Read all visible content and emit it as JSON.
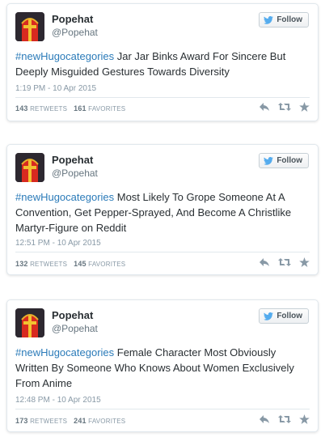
{
  "colors": {
    "hashtag": "#2b7bb9",
    "muted": "#8899a6",
    "border": "#e1e8ed",
    "follow_bird": "#55acee"
  },
  "tweets": [
    {
      "name": "Popehat",
      "handle": "@Popehat",
      "follow_label": "Follow",
      "hashtag": "#newHugocategories",
      "body": " Jar Jar Binks Award For Sincere But Deeply Misguided Gestures Towards Diversity",
      "timestamp": "1:19 PM - 10 Apr 2015",
      "retweets": "143",
      "retweets_label": "RETWEETS",
      "favorites": "161",
      "favorites_label": "FAVORITES",
      "icons": [
        "reply-icon",
        "retweet-icon",
        "favorite-icon"
      ]
    },
    {
      "name": "Popehat",
      "handle": "@Popehat",
      "follow_label": "Follow",
      "hashtag": "#newHugocategories",
      "body": " Most Likely To Grope Someone At A Convention, Get Pepper-Sprayed, And Become A Christlike Martyr-Figure on Reddit",
      "timestamp": "12:51 PM - 10 Apr 2015",
      "retweets": "132",
      "retweets_label": "RETWEETS",
      "favorites": "145",
      "favorites_label": "FAVORITES",
      "icons": [
        "reply-icon",
        "retweet-icon",
        "favorite-icon"
      ]
    },
    {
      "name": "Popehat",
      "handle": "@Popehat",
      "follow_label": "Follow",
      "hashtag": "#newHugocategories",
      "body": " Female Character Most Obviously Written By Someone Who Knows About Women Exclusively From Anime",
      "timestamp": "12:48 PM - 10 Apr 2015",
      "retweets": "173",
      "retweets_label": "RETWEETS",
      "favorites": "241",
      "favorites_label": "FAVORITES",
      "icons": [
        "reply-icon",
        "retweet-icon",
        "favorite-icon"
      ]
    }
  ]
}
